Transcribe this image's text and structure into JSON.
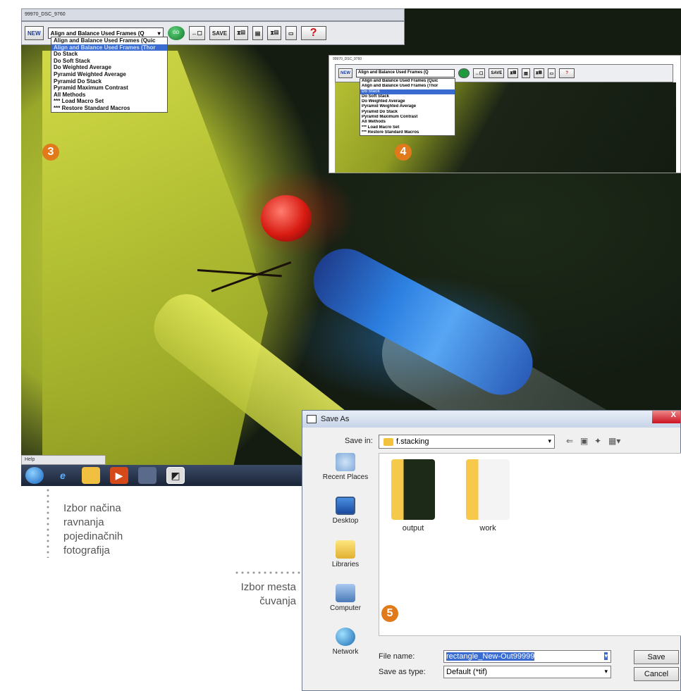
{
  "main_window": {
    "title": "99970_DSC_9760",
    "toolbar": {
      "new_label": "NEW",
      "method_selected": "Align and Balance Used Frames (Q",
      "go_label": "GO",
      "save_label": "SAVE",
      "help_label": "?"
    },
    "method_options": [
      "Align and Balance Used Frames (Quic",
      "Align and Balance Used Frames (Thor",
      "Do Stack",
      "Do Soft Stack",
      "Do Weighted Average",
      "Pyramid Weighted Average",
      "Pyramid Do Stack",
      "Pyramid Maximum Contrast",
      "All Methods",
      "*** Load Macro Set",
      "*** Restore Standard Macros"
    ],
    "selected_index": 1
  },
  "inset_window": {
    "title": "99970_DSC_9760",
    "toolbar": {
      "new_label": "NEW",
      "method_selected": "Align and Balance Used Frames (Q",
      "save_label": "SAVE",
      "help_label": "?"
    },
    "method_options": [
      "Align and Balance Used Frames (Quic",
      "Align and Balance Used Frames (Thor",
      "Do Stack",
      "Do Soft Stack",
      "Do Weighted Average",
      "Pyramid Weighted Average",
      "Pyramid Do Stack",
      "Pyramid Maximum Contrast",
      "All Methods",
      "*** Load Macro Set",
      "*** Restore Standard Macros"
    ],
    "selected_index": 2
  },
  "badges": {
    "b3": "3",
    "b4": "4",
    "b5": "5"
  },
  "help_strip": "Help",
  "captions": {
    "left_lines": [
      "Izbor načina",
      "ravnanja",
      "pojedinačnih",
      "fotografija"
    ],
    "right_lines": [
      "Izbor mesta",
      "čuvanja"
    ]
  },
  "save_dialog": {
    "title": "Save As",
    "close_label": "X",
    "save_in_label": "Save in:",
    "save_in_value": "f.stacking",
    "places": [
      "Recent Places",
      "Desktop",
      "Libraries",
      "Computer",
      "Network"
    ],
    "files": [
      "output",
      "work"
    ],
    "file_name_label": "File name:",
    "file_name_value": "rectangle_New-Out99999",
    "save_type_label": "Save as type:",
    "save_type_value": "Default (*tif)",
    "save_button": "Save",
    "cancel_button": "Cancel"
  },
  "colors": {
    "badge": "#e07a1a",
    "selection": "#3a6bd0",
    "help_red": "#d01010"
  }
}
